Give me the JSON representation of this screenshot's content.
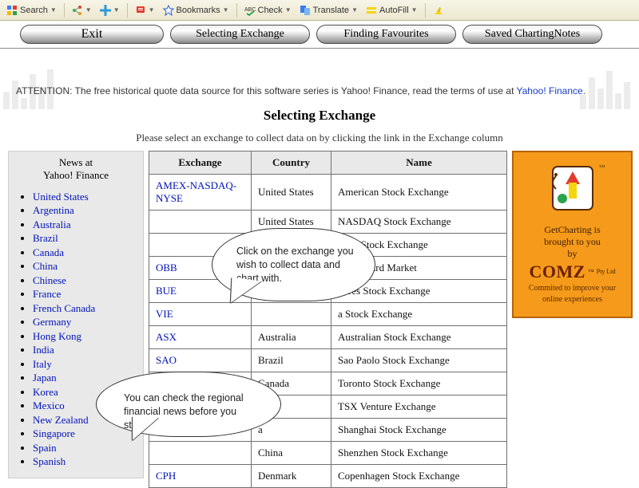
{
  "toolbar": {
    "search": "Search",
    "bookmarks": "Bookmarks",
    "check": "Check",
    "translate": "Translate",
    "autofill": "AutoFill"
  },
  "nav": {
    "exit": "Exit",
    "selecting": "Selecting Exchange",
    "finding": "Finding Favourites",
    "saved": "Saved ChartingNotes"
  },
  "attention": {
    "prefix": "ATTENTION: The free historical quote data source for this software series is Yahoo! Finance, read the terms of use at ",
    "link_text": "Yahoo! Finance",
    "suffix": "."
  },
  "heading": {
    "title": "Selecting Exchange",
    "sub": "Please select an exchange to collect data on by clicking the link in the Exchange column"
  },
  "news": {
    "line1": "News at",
    "line2": "Yahoo! Finance",
    "items": [
      "United States",
      "Argentina",
      "Australia",
      "Brazil",
      "Canada",
      "China",
      "Chinese",
      "France",
      "French Canada",
      "Germany",
      "Hong Kong",
      "India",
      "Italy",
      "Japan",
      "Korea",
      "Mexico",
      "New Zealand",
      "Singapore",
      "Spain",
      "Spanish"
    ]
  },
  "table": {
    "h_exchange": "Exchange",
    "h_country": "Country",
    "h_name": "Name",
    "rows": [
      {
        "ex": "AMEX-NASDAQ-NYSE",
        "co": "United States",
        "na": "American Stock Exchange"
      },
      {
        "ex": "",
        "co": "United States",
        "na": "NASDAQ Stock Exchange"
      },
      {
        "ex": "",
        "co": "",
        "na": "York Stock Exchange"
      },
      {
        "ex": "OBB",
        "co": "",
        "na": "letin Board Market"
      },
      {
        "ex": "BUE",
        "co": "",
        "na": "Aires Stock Exchange"
      },
      {
        "ex": "VIE",
        "co": "",
        "na": "a Stock Exchange"
      },
      {
        "ex": "ASX",
        "co": "Australia",
        "na": "Australian Stock Exchange"
      },
      {
        "ex": "SAO",
        "co": "Brazil",
        "na": "Sao Paolo Stock Exchange"
      },
      {
        "ex": "",
        "co": "Canada",
        "na": "Toronto Stock Exchange"
      },
      {
        "ex": "",
        "co": "ada",
        "na": "TSX Venture Exchange"
      },
      {
        "ex": "",
        "co": "a",
        "na": "Shanghai Stock Exchange"
      },
      {
        "ex": "",
        "co": "China",
        "na": "Shenzhen Stock Exchange"
      },
      {
        "ex": "CPH",
        "co": "Denmark",
        "na": "Copenhagen Stock Exchange"
      }
    ]
  },
  "promo": {
    "l1": "GetCharting is",
    "l2": "brought to you",
    "l3": "by",
    "brand": "COMZ",
    "pty": "Pty Ltd",
    "tag1": "Commited to improve your",
    "tag2": "online experiences"
  },
  "callouts": {
    "c1": "Click on the exchange you wish to  collect data and chart with.",
    "c2": "You can check the regional financial news before you start."
  }
}
